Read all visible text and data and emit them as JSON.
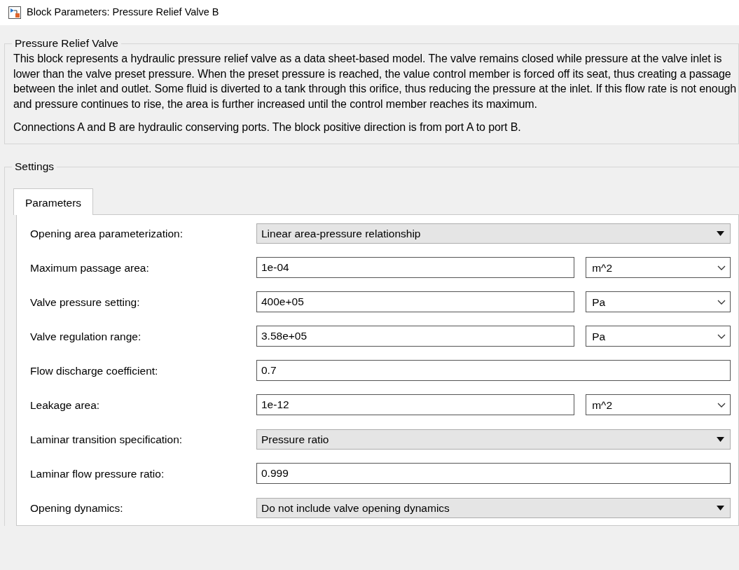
{
  "window": {
    "title": "Block Parameters: Pressure Relief Valve B"
  },
  "description": {
    "title": "Pressure Relief Valve",
    "paragraphs": [
      "This block represents a hydraulic pressure relief valve as a data sheet-based model. The valve remains closed while pressure at the valve inlet is lower than the valve preset pressure. When the preset pressure is reached, the value control member is forced off its seat, thus creating a passage between the inlet and outlet. Some fluid is diverted to a tank through this orifice, thus reducing the pressure at the inlet. If this flow rate is not enough and pressure continues to rise, the area is further increased until the control member reaches its maximum.",
      "Connections A and B are hydraulic conserving ports. The block positive direction is from port A to port B."
    ]
  },
  "settings": {
    "title": "Settings",
    "tabs": [
      {
        "label": "Parameters",
        "selected": true
      }
    ],
    "parameters": [
      {
        "kind": "dropdown",
        "label": "Opening area parameterization:",
        "value": "Linear area-pressure relationship"
      },
      {
        "kind": "field_unit",
        "label": "Maximum passage area:",
        "value": "1e-04",
        "unit": "m^2"
      },
      {
        "kind": "field_unit",
        "label": "Valve pressure setting:",
        "value": "400e+05",
        "unit": "Pa"
      },
      {
        "kind": "field_unit",
        "label": "Valve regulation range:",
        "value": "3.58e+05",
        "unit": "Pa"
      },
      {
        "kind": "field",
        "label": "Flow discharge coefficient:",
        "value": "0.7"
      },
      {
        "kind": "field_unit",
        "label": "Leakage area:",
        "value": "1e-12",
        "unit": "m^2"
      },
      {
        "kind": "dropdown",
        "label": "Laminar transition specification:",
        "value": "Pressure ratio"
      },
      {
        "kind": "field",
        "label": "Laminar flow pressure ratio:",
        "value": "0.999"
      },
      {
        "kind": "dropdown",
        "label": "Opening dynamics:",
        "value": "Do not include valve opening dynamics"
      }
    ]
  }
}
